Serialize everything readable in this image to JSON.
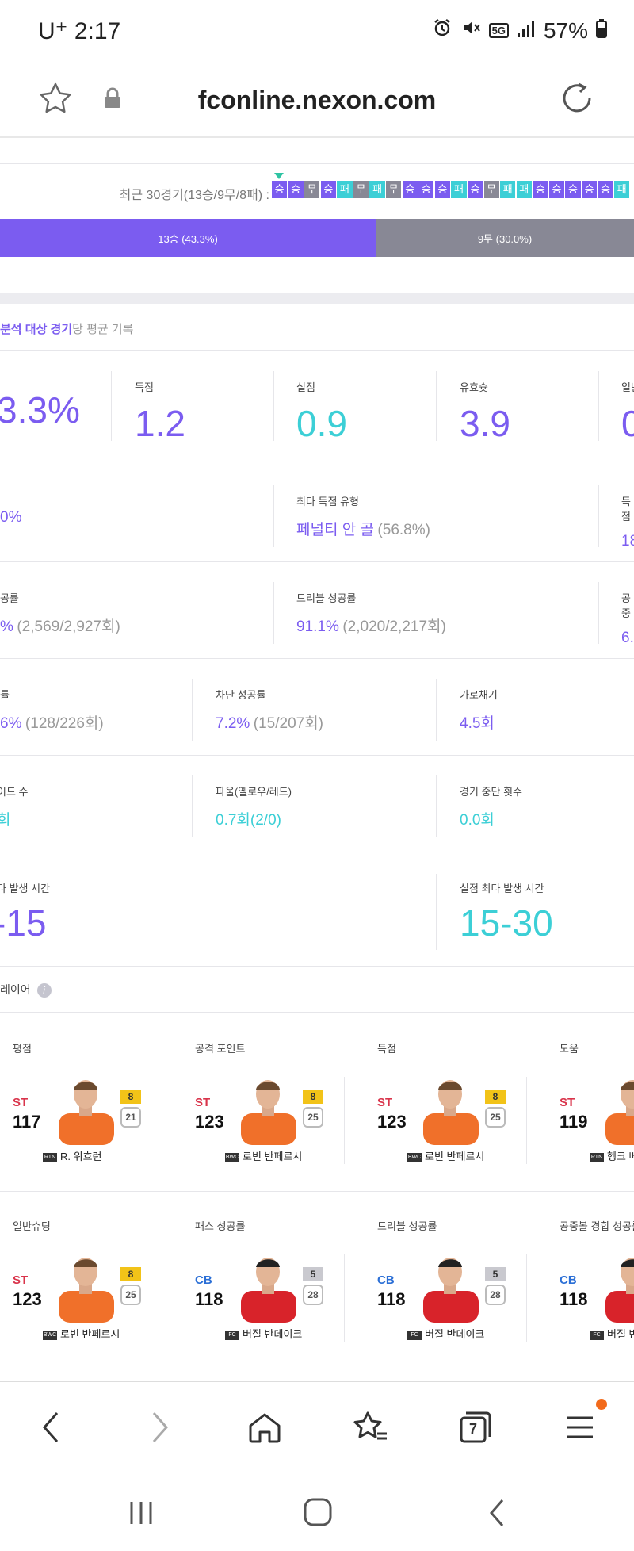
{
  "status_bar": {
    "carrier": "U⁺",
    "time": "2:17",
    "battery": "57%",
    "network": "5G"
  },
  "browser": {
    "url": "fconline.nexon.com",
    "tabs_count": "7"
  },
  "recent": {
    "label": "최근 30경기(13승/9무/8패) :",
    "results": [
      "승",
      "승",
      "무",
      "승",
      "패",
      "무",
      "패",
      "무",
      "승",
      "승",
      "승",
      "패",
      "승",
      "무",
      "패",
      "패",
      "승",
      "승",
      "승",
      "승",
      "승",
      "패"
    ]
  },
  "bar": {
    "win_label": "13승 (43.3%)",
    "draw_label": "9무 (30.0%)"
  },
  "avg": {
    "title_bold": "분석 대상 경기",
    "title_rest": "당 평균 기록"
  },
  "row1": [
    {
      "label": "",
      "value": "3.3%"
    },
    {
      "label": "득점",
      "value": "1.2"
    },
    {
      "label": "실점",
      "value": "0.9"
    },
    {
      "label": "유효슛",
      "value": "3.9"
    },
    {
      "label": "일반",
      "value": "0"
    }
  ],
  "row2": [
    {
      "value": "0%"
    },
    {
      "label": "최다 득점 유형",
      "value": "페널티 안 골",
      "extra": "(56.8%)"
    },
    {
      "label": "득점",
      "value": "18"
    }
  ],
  "row3": [
    {
      "label": "성공률",
      "value": "%",
      "extra": "(2,569/2,927회)"
    },
    {
      "label": "드리블 성공률",
      "value": "91.1%",
      "extra": "(2,020/2,217회)"
    },
    {
      "label": "공중",
      "value": "6."
    }
  ],
  "row4": [
    {
      "label": "공률",
      "value": "6%",
      "extra": "(128/226회)"
    },
    {
      "label": "차단 성공률",
      "value": "7.2%",
      "extra": "(15/207회)"
    },
    {
      "label": "가로채기",
      "value": "4.5회"
    }
  ],
  "row5": [
    {
      "label": "이드 수",
      "value": "회"
    },
    {
      "label": "파울(옐로우/레드)",
      "value": "0.7회(2/0)"
    },
    {
      "label": "경기 중단 횟수",
      "value": "0.0회"
    }
  ],
  "row6": [
    {
      "label": "다 발생 시간",
      "value": "-15"
    },
    {
      "label": "실점 최다 발생 시간",
      "value": "15-30"
    }
  ],
  "players_title": "레이어",
  "cards_row1": [
    {
      "title": "평점",
      "pos": "ST",
      "ovr": "117",
      "grade": "8",
      "level": "21",
      "badge": "RTN",
      "name": "R. 위흐런"
    },
    {
      "title": "공격 포인트",
      "pos": "ST",
      "ovr": "123",
      "grade": "8",
      "level": "25",
      "badge": "BWC",
      "name": "로빈 반페르시"
    },
    {
      "title": "득점",
      "pos": "ST",
      "ovr": "123",
      "grade": "8",
      "level": "25",
      "badge": "BWC",
      "name": "로빈 반페르시"
    },
    {
      "title": "도움",
      "pos": "ST",
      "ovr": "119",
      "grade": "",
      "level": "",
      "badge": "RTN",
      "name": "헹크 베"
    }
  ],
  "cards_row2": [
    {
      "title": "일반슈팅",
      "pos": "ST",
      "ovr": "123",
      "grade": "8",
      "level": "25",
      "badge": "BWC",
      "name": "로빈 반페르시"
    },
    {
      "title": "패스 성공률",
      "pos": "CB",
      "ovr": "118",
      "grade": "5",
      "level": "28",
      "badge": "FC",
      "name": "버질 반데이크"
    },
    {
      "title": "드리블 성공률",
      "pos": "CB",
      "ovr": "118",
      "grade": "5",
      "level": "28",
      "badge": "FC",
      "name": "버질 반데이크"
    },
    {
      "title": "공중볼 경합 성공률",
      "pos": "CB",
      "ovr": "118",
      "grade": "",
      "level": "",
      "badge": "FC",
      "name": "버질 반데"
    }
  ],
  "colors": {
    "accent": "#7b5cf0",
    "teal": "#3ccfd6",
    "win": "#7b5cf0",
    "draw": "#888895",
    "loss": "#3ccfd6",
    "st": "#d9344b",
    "cb": "#2b6fd6"
  }
}
